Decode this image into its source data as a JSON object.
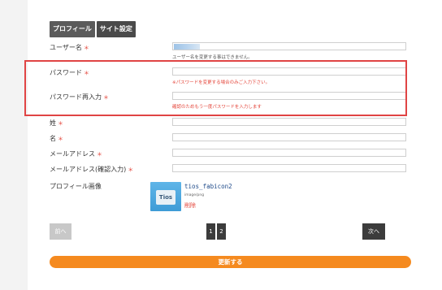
{
  "tabs": [
    {
      "label": "プロフィール"
    },
    {
      "label": "サイト設定"
    }
  ],
  "required_mark": "＊",
  "fields": {
    "username": {
      "label": "ユーザー名",
      "hint": "ユーザー名を変更する事はできません。"
    },
    "password": {
      "label": "パスワード",
      "hint": "※パスワードを変更する場合のみご入力下さい。"
    },
    "password_confirm": {
      "label": "パスワード再入力",
      "hint": "確認のためもう一度パスワードを入力します"
    },
    "last_name": {
      "label": "姓"
    },
    "first_name": {
      "label": "名"
    },
    "email": {
      "label": "メールアドレス"
    },
    "email_confirm": {
      "label": "メールアドレス(確認入力)"
    },
    "profile_image": {
      "label": "プロフィール画像",
      "file_name": "tios_fabicon2",
      "file_type": "image/png",
      "delete_label": "削除",
      "thumb_text": "Tios"
    }
  },
  "pagination": {
    "prev": "前へ",
    "next": "次へ",
    "pages": [
      "1",
      "2"
    ]
  },
  "submit_label": "更新する",
  "colors": {
    "accent": "#f58a1f",
    "required": "#e4453a",
    "highlight": "#e04444"
  }
}
